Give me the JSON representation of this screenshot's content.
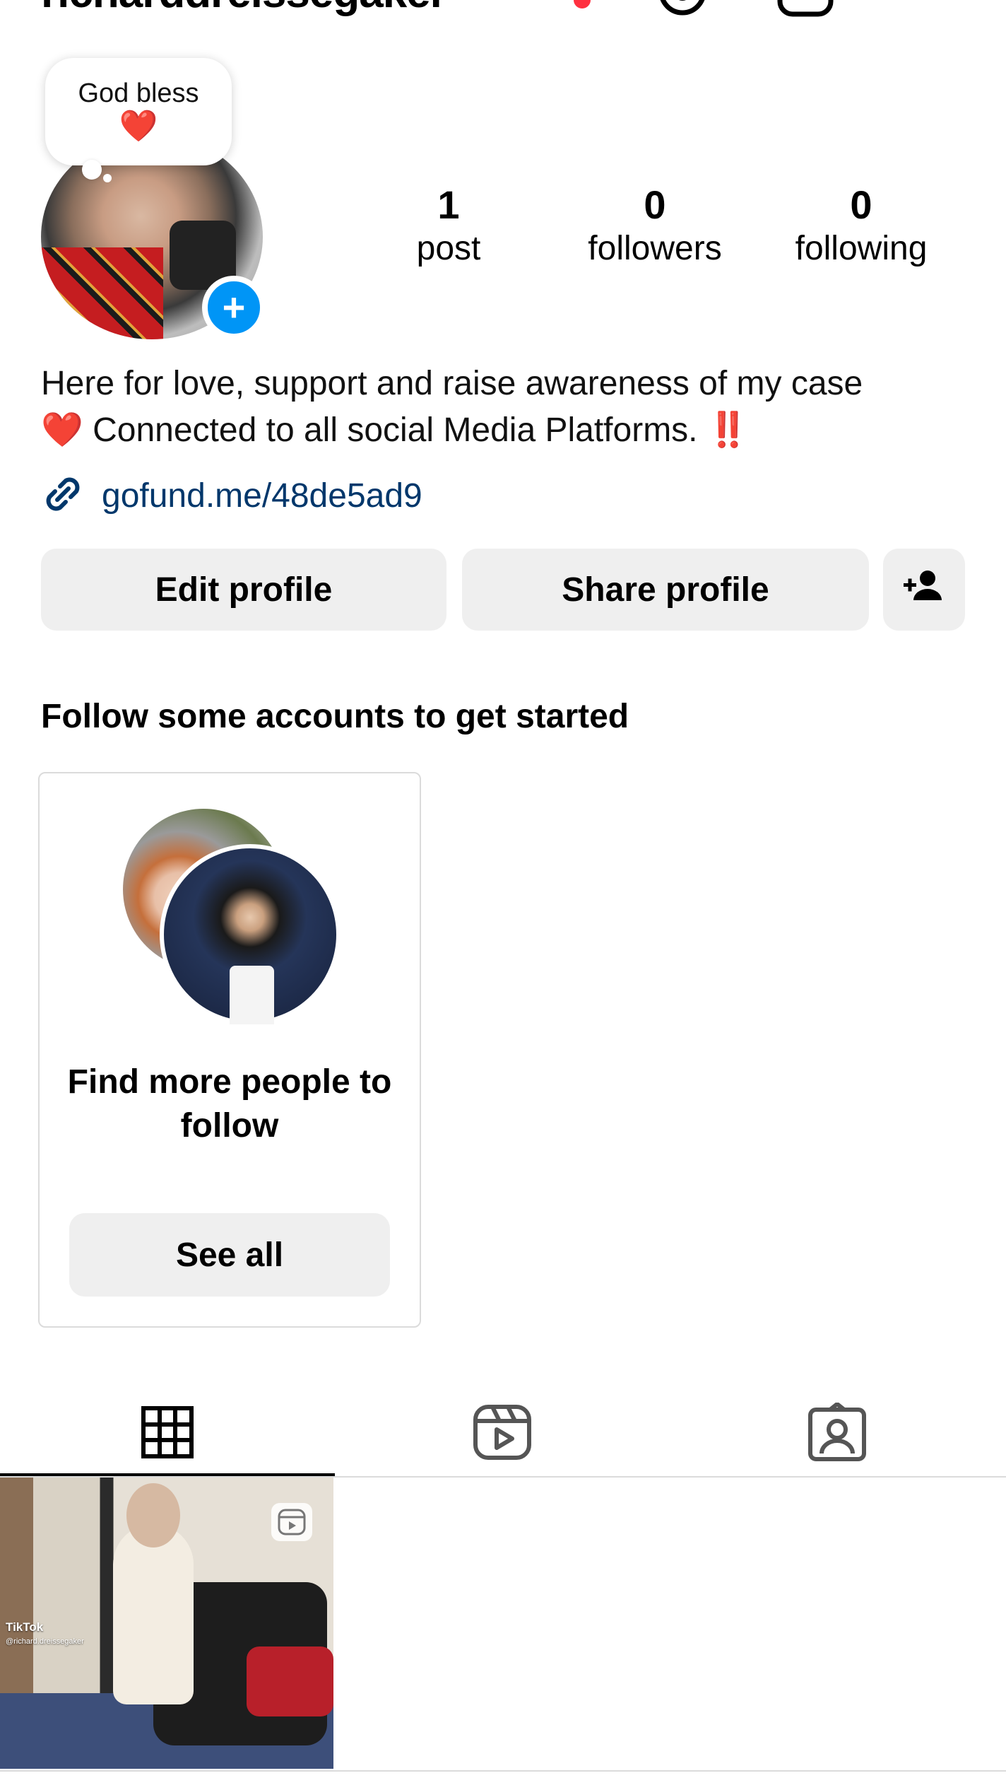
{
  "header": {
    "username": "richarddreissegaker",
    "icons": [
      "threads-icon",
      "new-post-icon",
      "menu-icon"
    ]
  },
  "note": {
    "text": "God bless",
    "emoji": "❤️"
  },
  "stats": {
    "posts": {
      "count": "1",
      "label": "post"
    },
    "followers": {
      "count": "0",
      "label": "followers"
    },
    "following": {
      "count": "0",
      "label": "following"
    }
  },
  "bio": {
    "line1": "Here for love, support and raise awareness of my case",
    "heart": "❤️",
    "line2": "Connected to all social Media Platforms.",
    "exclaim": "‼️",
    "link": "gofund.me/48de5ad9"
  },
  "buttons": {
    "edit": "Edit profile",
    "share": "Share profile"
  },
  "suggestions": {
    "title": "Follow some accounts to get started",
    "card_title": "Find more people to follow",
    "see_all": "See all"
  },
  "post": {
    "watermark": "TikTok",
    "handle": "@richard.dreissegaker"
  },
  "colors": {
    "accent_blue": "#0095f6",
    "link_blue": "#00376b",
    "button_gray": "#efefef",
    "heart_red": "#e0242b"
  }
}
